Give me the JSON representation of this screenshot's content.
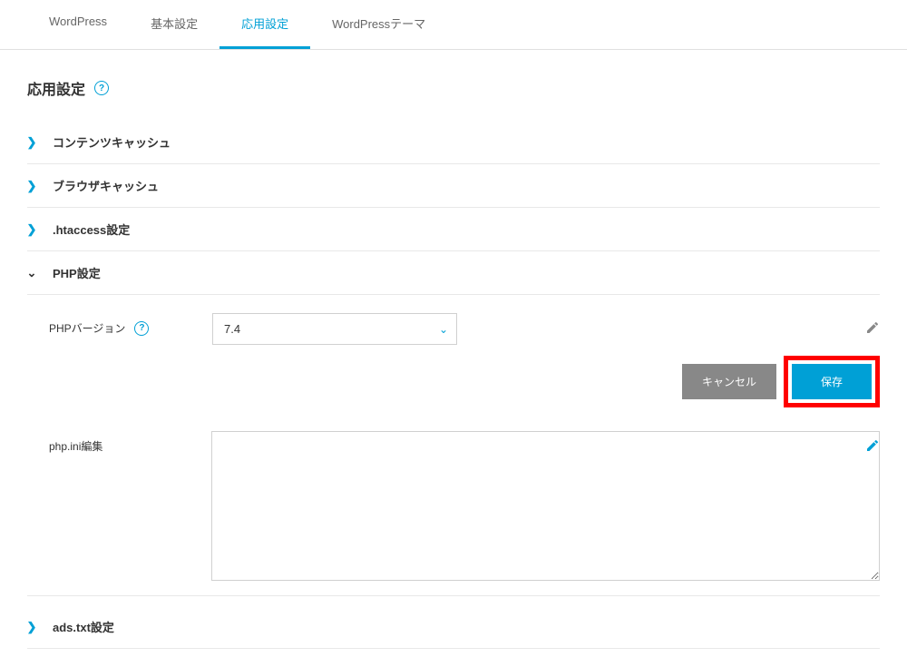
{
  "tabs": [
    {
      "label": "WordPress",
      "active": false
    },
    {
      "label": "基本設定",
      "active": false
    },
    {
      "label": "応用設定",
      "active": true
    },
    {
      "label": "WordPressテーマ",
      "active": false
    }
  ],
  "page_title": "応用設定",
  "accordion": {
    "content_cache": "コンテンツキャッシュ",
    "browser_cache": "ブラウザキャッシュ",
    "htaccess": ".htaccess設定",
    "php": "PHP設定",
    "ads_txt": "ads.txt設定"
  },
  "php_panel": {
    "version_label": "PHPバージョン",
    "version_value": "7.4",
    "ini_label": "php.ini編集",
    "ini_value": ""
  },
  "buttons": {
    "cancel": "キャンセル",
    "save": "保存"
  }
}
